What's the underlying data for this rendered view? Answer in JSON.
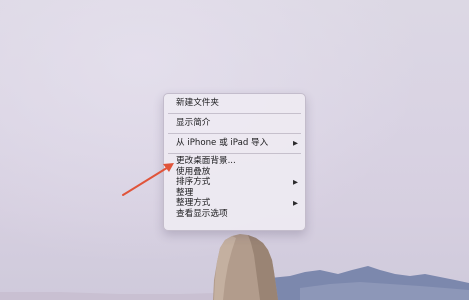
{
  "context_menu": {
    "items": [
      {
        "label": "新建文件夹",
        "has_submenu": false
      },
      {
        "label": "显示简介",
        "has_submenu": false
      },
      {
        "label": "从 iPhone 或 iPad 导入",
        "has_submenu": true
      },
      {
        "label": "更改桌面背景...",
        "has_submenu": false
      },
      {
        "label": "使用叠放",
        "has_submenu": false
      },
      {
        "label": "排序方式",
        "has_submenu": true
      },
      {
        "label": "整理",
        "has_submenu": false
      },
      {
        "label": "整理方式",
        "has_submenu": true
      },
      {
        "label": "查看显示选项",
        "has_submenu": false
      }
    ],
    "submenu_glyph": "▶"
  },
  "annotation": {
    "arrow_color": "#e0543a",
    "points_to": "更改桌面背景..."
  }
}
